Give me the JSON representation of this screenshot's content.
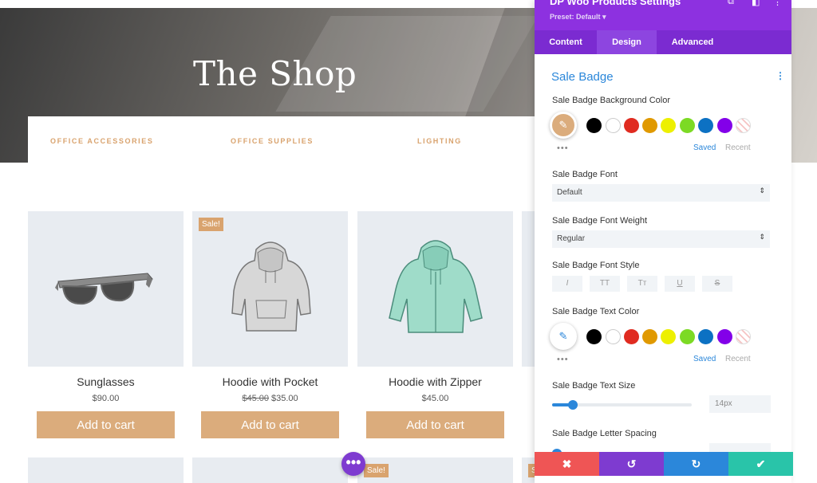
{
  "hero": {
    "title": "The Shop"
  },
  "categories": [
    "OFFICE ACCESSORIES",
    "OFFICE SUPPLIES",
    "LIGHTING"
  ],
  "products": [
    {
      "name": "Sunglasses",
      "price": "$90.00",
      "old_price": "",
      "sale": ""
    },
    {
      "name": "Hoodie with Pocket",
      "price": "$35.00",
      "old_price": "$45.00",
      "sale": "Sale!"
    },
    {
      "name": "Hoodie with Zipper",
      "price": "$45.00",
      "old_price": "",
      "sale": ""
    }
  ],
  "add_to_cart": "Add to cart",
  "row2_sale_labels": [
    "Sale!",
    "Sale!"
  ],
  "fab_label": "•••",
  "panel": {
    "title": "DP Woo Products Settings",
    "preset": "Preset: Default ▾",
    "tabs": [
      "Content",
      "Design",
      "Advanced"
    ],
    "active_tab": "Design",
    "section_title": "Sale Badge",
    "bg_color_label": "Sale Badge Background Color",
    "font_label": "Sale Badge Font",
    "font_value": "Default",
    "font_weight_label": "Sale Badge Font Weight",
    "font_weight_value": "Regular",
    "font_style_label": "Sale Badge Font Style",
    "font_style_buttons": [
      "I",
      "TT",
      "Tт",
      "U",
      "S"
    ],
    "text_color_label": "Sale Badge Text Color",
    "text_size_label": "Sale Badge Text Size",
    "text_size_value": "14px",
    "text_size_fraction": 0.15,
    "letter_spacing_label": "Sale Badge Letter Spacing",
    "saved": "Saved",
    "recent": "Recent",
    "more": "•••"
  },
  "colors": {
    "accent": "#d9a36e",
    "panel_purple": "#8d31e0",
    "blue": "#2b87da",
    "swatches": [
      "#000000",
      "#ffffff",
      "#e02b20",
      "#e09900",
      "#edf000",
      "#7cda24",
      "#0c71c3",
      "#8300e9"
    ],
    "bg_selected": "#dbac7c",
    "footer": [
      "#ef5555",
      "#7e3bd0",
      "#2b87da",
      "#29c4a9"
    ]
  }
}
